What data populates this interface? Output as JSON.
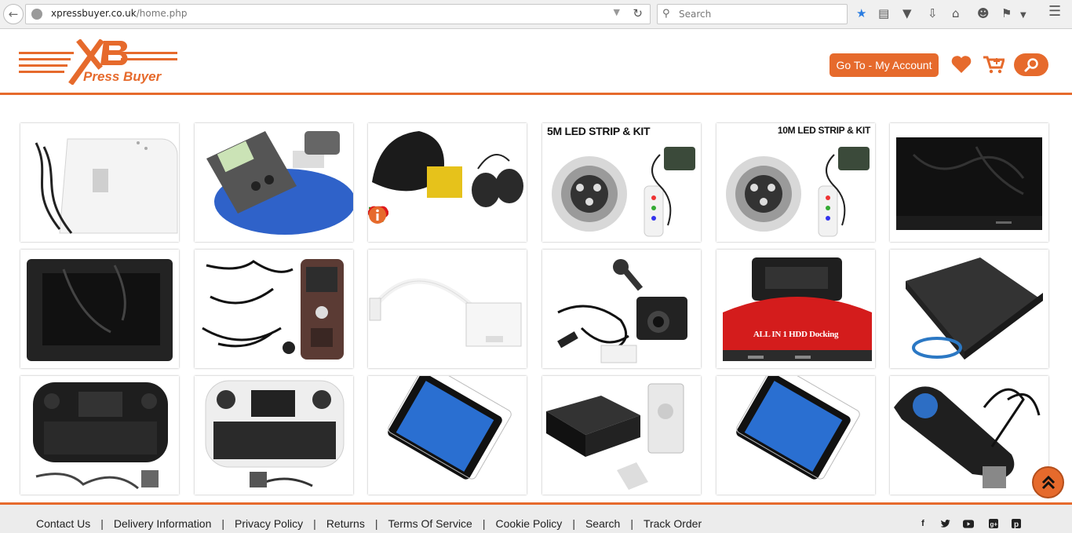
{
  "browser": {
    "url_domain": "xpressbuyer.co.uk",
    "url_path": "/home.php",
    "search_placeholder": "Search"
  },
  "header": {
    "account_button": "Go To - My Account",
    "brand_color": "#e66a2c"
  },
  "products": [
    {
      "kind": "wifi-extender",
      "label": ""
    },
    {
      "kind": "moisture-meter",
      "label": ""
    },
    {
      "kind": "binocular-kit",
      "label": ""
    },
    {
      "kind": "led-strip",
      "label": "5M LED STRIP & KIT"
    },
    {
      "kind": "led-strip",
      "label": "10M LED STRIP & KIT"
    },
    {
      "kind": "dvd-drive",
      "label": ""
    },
    {
      "kind": "dvd-drive-case",
      "label": ""
    },
    {
      "kind": "voice-recorder",
      "label": ""
    },
    {
      "kind": "vga-adapter",
      "label": ""
    },
    {
      "kind": "dash-camera",
      "label": ""
    },
    {
      "kind": "hdd-dock",
      "label": "ALL IN 1 HDD Docking"
    },
    {
      "kind": "hdd-enclosure",
      "label": ""
    },
    {
      "kind": "mini-keyboard-black",
      "label": ""
    },
    {
      "kind": "mini-keyboard-white",
      "label": ""
    },
    {
      "kind": "tablet-screen-protector",
      "label": ""
    },
    {
      "kind": "hdmi-switch",
      "label": ""
    },
    {
      "kind": "tablet-screen-protector",
      "label": ""
    },
    {
      "kind": "hdmi-dongle",
      "label": ""
    }
  ],
  "hover_actions": [
    "view-icon",
    "add-to-cart-icon",
    "wishlist-icon",
    "info-icon"
  ],
  "footer": {
    "links": [
      "Contact Us",
      "Delivery Information",
      "Privacy Policy",
      "Returns",
      "Terms Of Service",
      "Cookie Policy",
      "Search",
      "Track Order"
    ],
    "social": [
      "facebook-icon",
      "twitter-icon",
      "youtube-icon",
      "google-plus-icon",
      "pinterest-icon"
    ]
  }
}
